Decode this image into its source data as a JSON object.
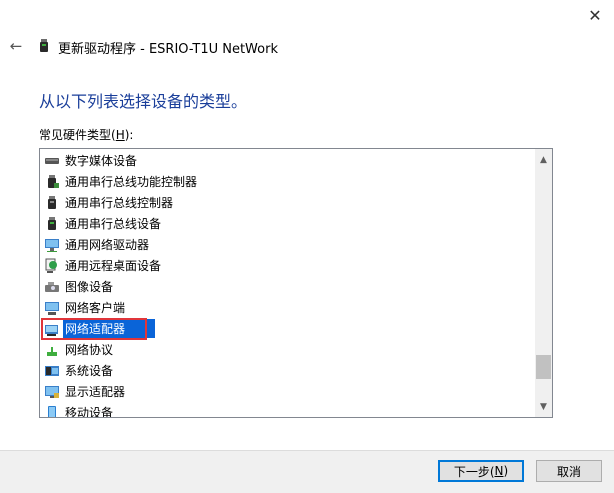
{
  "window": {
    "close_glyph": "✕",
    "back_glyph": "←",
    "title": "更新驱动程序 - ESRIO-T1U NetWork"
  },
  "heading": "从以下列表选择设备的类型。",
  "list": {
    "label_prefix": "常见硬件类型(",
    "label_accel": "H",
    "label_suffix": "):",
    "items": [
      {
        "label": "数字媒体设备",
        "icon": "digital-media-icon"
      },
      {
        "label": "通用串行总线功能控制器",
        "icon": "usb-function-controller-icon"
      },
      {
        "label": "通用串行总线控制器",
        "icon": "usb-controller-icon"
      },
      {
        "label": "通用串行总线设备",
        "icon": "usb-device-icon"
      },
      {
        "label": "通用网络驱动器",
        "icon": "network-drive-icon"
      },
      {
        "label": "通用远程桌面设备",
        "icon": "remote-desktop-icon"
      },
      {
        "label": "图像设备",
        "icon": "imaging-device-icon"
      },
      {
        "label": "网络客户端",
        "icon": "network-client-icon"
      },
      {
        "label": "网络适配器",
        "icon": "network-adapter-icon",
        "selected": true
      },
      {
        "label": "网络协议",
        "icon": "network-protocol-icon"
      },
      {
        "label": "系统设备",
        "icon": "system-device-icon"
      },
      {
        "label": "显示适配器",
        "icon": "display-adapter-icon"
      },
      {
        "label": "移动设备",
        "icon": "mobile-device-icon"
      }
    ]
  },
  "buttons": {
    "next_prefix": "下一步(",
    "next_accel": "N",
    "next_suffix": ")",
    "cancel": "取消"
  },
  "colors": {
    "heading": "#1a3e9a",
    "selection": "#0a64d8",
    "highlight": "#e0353a"
  }
}
